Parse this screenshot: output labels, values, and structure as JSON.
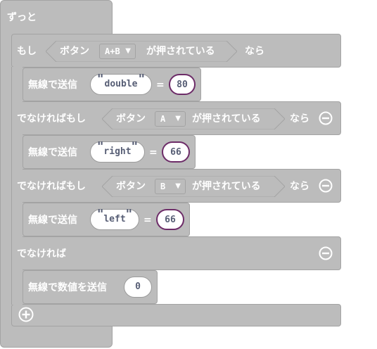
{
  "colors": {
    "block": "#bcbcbc",
    "block_border": "#a3a3a3",
    "text": "#ffffff",
    "number_border": "#6d2c68",
    "field_text": "#575e75"
  },
  "forever": {
    "label": "ずっと"
  },
  "if_block": {
    "if_label": "もし",
    "then_label": "なら",
    "condition": {
      "button_label": "ボタン",
      "button_value": "A+B",
      "pressed_label": "が押されている"
    },
    "statement": {
      "label": "無線で送信",
      "name": "double",
      "eq": "=",
      "value": "80"
    }
  },
  "elseif_1": {
    "label": "でなければもし",
    "then_label": "なら",
    "condition": {
      "button_label": "ボタン",
      "button_value": "A",
      "pressed_label": "が押されている"
    },
    "statement": {
      "label": "無線で送信",
      "name": "right",
      "eq": "=",
      "value": "66"
    }
  },
  "elseif_2": {
    "label": "でなければもし",
    "then_label": "なら",
    "condition": {
      "button_label": "ボタン",
      "button_value": "B",
      "pressed_label": "が押されている"
    },
    "statement": {
      "label": "無線で送信",
      "name": "left",
      "eq": "=",
      "value": "66"
    }
  },
  "else_block": {
    "label": "でなければ",
    "statement": {
      "label": "無線で数値を送信",
      "value": "0"
    }
  },
  "quote_char": "\"",
  "icons": {
    "remove": "minus-circle-icon",
    "add": "plus-circle-icon",
    "dropdown": "caret-down-icon"
  }
}
